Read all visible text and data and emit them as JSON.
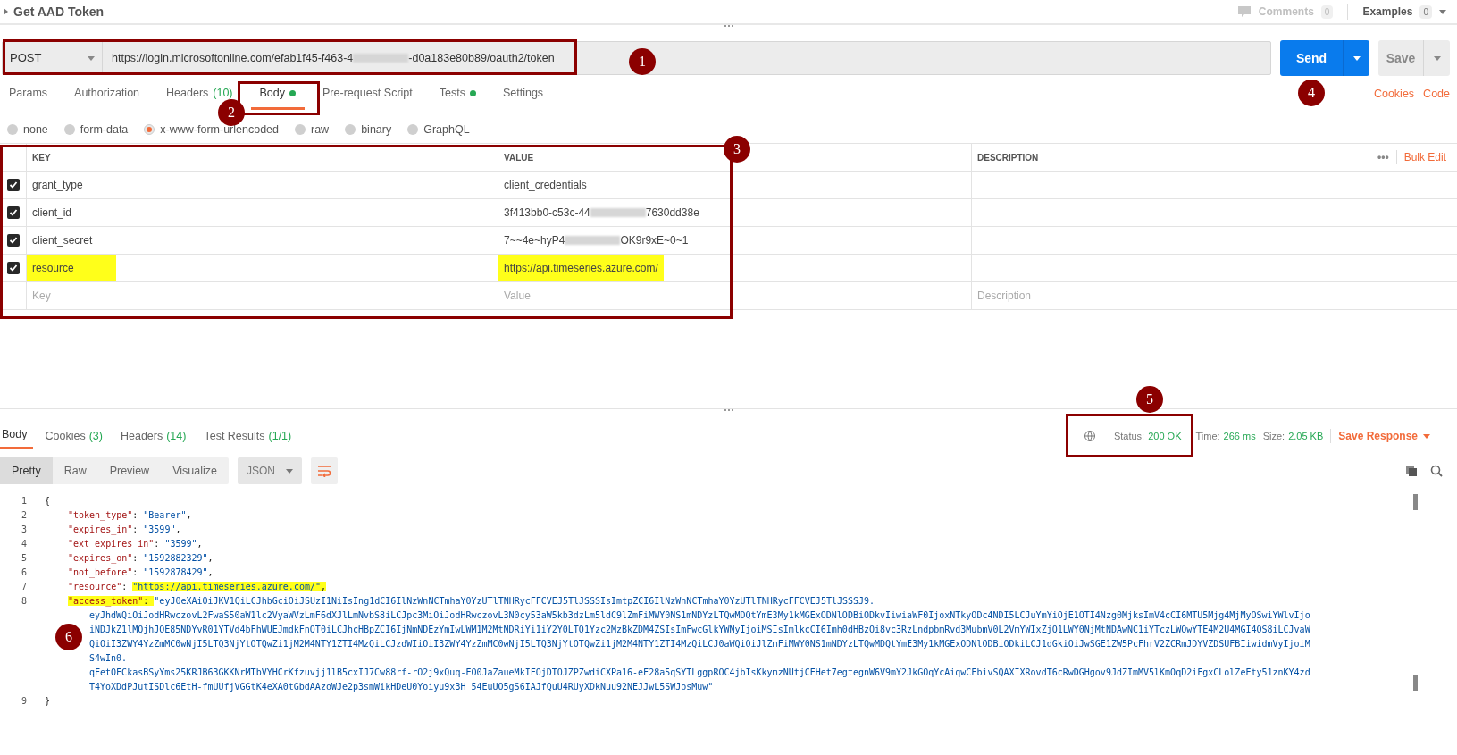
{
  "request": {
    "title": "Get AAD Token",
    "comments": {
      "label": "Comments",
      "count": "0",
      "disabled": true
    },
    "examples": {
      "label": "Examples",
      "count": "0"
    }
  },
  "url_bar": {
    "method": "POST",
    "url_parts": [
      {
        "kind": "text",
        "text": "https://login.microsoftonline.com/efab1f45-f463-4"
      },
      {
        "kind": "redacted"
      },
      {
        "kind": "text",
        "text": "-d0a183e80b89/oauth2/token"
      }
    ],
    "send": "Send",
    "save": "Save"
  },
  "request_tabs": [
    {
      "label": "Params",
      "selected": false
    },
    {
      "label": "Authorization",
      "selected": false
    },
    {
      "label": "Headers",
      "count": "(10)",
      "selected": false
    },
    {
      "label": "Body",
      "dot": true,
      "selected": true
    },
    {
      "label": "Pre-request Script",
      "selected": false
    },
    {
      "label": "Tests",
      "dot": true,
      "selected": false
    },
    {
      "label": "Settings",
      "selected": false
    }
  ],
  "request_links": [
    "Cookies",
    "Code"
  ],
  "body_types": [
    {
      "label": "none",
      "selected": false
    },
    {
      "label": "form-data",
      "selected": false
    },
    {
      "label": "x-www-form-urlencoded",
      "selected": true
    },
    {
      "label": "raw",
      "selected": false
    },
    {
      "label": "binary",
      "selected": false
    },
    {
      "label": "GraphQL",
      "selected": false
    }
  ],
  "params_table": {
    "columns": [
      "KEY",
      "VALUE",
      "DESCRIPTION"
    ],
    "more": "•••",
    "bulk_edit": "Bulk Edit",
    "rows": [
      {
        "checked": true,
        "highlighted": false,
        "key": "grant_type",
        "value": [
          {
            "kind": "text",
            "text": "client_credentials"
          }
        ]
      },
      {
        "checked": true,
        "highlighted": false,
        "key": "client_id",
        "value": [
          {
            "kind": "text",
            "text": "3f413bb0-c53c-44"
          },
          {
            "kind": "redacted"
          },
          {
            "kind": "text",
            "text": "7630dd38e"
          }
        ]
      },
      {
        "checked": true,
        "highlighted": false,
        "key": "client_secret",
        "value": [
          {
            "kind": "text",
            "text": "7~~4e~hyP4"
          },
          {
            "kind": "redacted"
          },
          {
            "kind": "text",
            "text": "OK9r9xE~0~1"
          }
        ]
      },
      {
        "checked": true,
        "highlighted": true,
        "key": "resource",
        "value": [
          {
            "kind": "text",
            "text": "https://api.timeseries.azure.com/"
          }
        ]
      }
    ],
    "placeholders": [
      "Key",
      "Value",
      "Description"
    ]
  },
  "response_tabs": [
    {
      "label": "Body",
      "selected": true
    },
    {
      "label": "Cookies",
      "count": "(3)",
      "selected": false
    },
    {
      "label": "Headers",
      "count": "(14)",
      "selected": false
    },
    {
      "label": "Test Results",
      "count": "(1/1)",
      "selected": false
    }
  ],
  "response_meta": {
    "status_label": "Status:",
    "status": "200 OK",
    "time_label": "Time:",
    "time": "266 ms",
    "size_label": "Size:",
    "size": "2.05 KB",
    "save_response": "Save Response"
  },
  "view_modes": [
    {
      "label": "Pretty",
      "selected": true
    },
    {
      "label": "Raw",
      "selected": false
    },
    {
      "label": "Preview",
      "selected": false
    },
    {
      "label": "Visualize",
      "selected": false
    }
  ],
  "format": "JSON",
  "code_lines": [
    {
      "number": "1",
      "tokens": [
        {
          "kind": "punct",
          "text": "{",
          "highlighted": false
        }
      ]
    },
    {
      "number": "2",
      "tokens": [
        {
          "kind": "key",
          "text": "\"token_type\"",
          "highlighted": false
        },
        {
          "kind": "punct",
          "text": ": ",
          "highlighted": false
        },
        {
          "kind": "string",
          "text": "\"Bearer\"",
          "highlighted": false
        },
        {
          "kind": "punct",
          "text": ",",
          "highlighted": false
        }
      ]
    },
    {
      "number": "3",
      "tokens": [
        {
          "kind": "key",
          "text": "\"expires_in\"",
          "highlighted": false
        },
        {
          "kind": "punct",
          "text": ": ",
          "highlighted": false
        },
        {
          "kind": "string",
          "text": "\"3599\"",
          "highlighted": false
        },
        {
          "kind": "punct",
          "text": ",",
          "highlighted": false
        }
      ]
    },
    {
      "number": "4",
      "tokens": [
        {
          "kind": "key",
          "text": "\"ext_expires_in\"",
          "highlighted": false
        },
        {
          "kind": "punct",
          "text": ": ",
          "highlighted": false
        },
        {
          "kind": "string",
          "text": "\"3599\"",
          "highlighted": false
        },
        {
          "kind": "punct",
          "text": ",",
          "highlighted": false
        }
      ]
    },
    {
      "number": "5",
      "tokens": [
        {
          "kind": "key",
          "text": "\"expires_on\"",
          "highlighted": false
        },
        {
          "kind": "punct",
          "text": ": ",
          "highlighted": false
        },
        {
          "kind": "string",
          "text": "\"1592882329\"",
          "highlighted": false
        },
        {
          "kind": "punct",
          "text": ",",
          "highlighted": false
        }
      ]
    },
    {
      "number": "6",
      "tokens": [
        {
          "kind": "key",
          "text": "\"not_before\"",
          "highlighted": false
        },
        {
          "kind": "punct",
          "text": ": ",
          "highlighted": false
        },
        {
          "kind": "string",
          "text": "\"1592878429\"",
          "highlighted": false
        },
        {
          "kind": "punct",
          "text": ",",
          "highlighted": false
        }
      ]
    },
    {
      "number": "7",
      "tokens": [
        {
          "kind": "key",
          "text": "\"resource\"",
          "highlighted": false
        },
        {
          "kind": "punct",
          "text": ": ",
          "highlighted": false
        },
        {
          "kind": "string",
          "text": "\"https://api.timeseries.azure.com/\"",
          "highlighted": true
        },
        {
          "kind": "punct",
          "text": ",",
          "highlighted": true
        }
      ]
    },
    {
      "number": "8",
      "tokens": [
        {
          "kind": "key",
          "text": "\"access_token\"",
          "highlighted": true
        },
        {
          "kind": "punct",
          "text": ": ",
          "highlighted": true
        },
        {
          "kind": "string",
          "text": "\"eyJ0eXAiOiJKV1QiLCJhbGciOiJSUzI1NiIsIng1dCI6IlNzWnNCTmhaY0YzUTlTNHRycFFCVEJ5TlJSSSIsImtpZCI6IlNzWnNCTmhaY0YzUTlTNHRycFFCVEJ5TlJSSSJ9.",
          "highlighted": false
        }
      ],
      "continuation": [
        "eyJhdWQiOiJodHRwczovL2FwaS50aW1lc2VyaWVzLmF6dXJlLmNvbS8iLCJpc3MiOiJodHRwczovL3N0cy53aW5kb3dzLm5ldC9lZmFiMWY0NS1mNDYzLTQwMDQtYmE3My1kMGExODNlODBiODkvIiwiaWF0IjoxNTkyODc4NDI5LCJuYmYiOjE1OTI4Nzg0MjksImV4cCI6MTU5Mjg4MjMyOSwiYWlvIjo",
        "iNDJkZ1lMQjhJOE85NDYvR01YTVd4bFhWUEJmdkFnQT0iLCJhcHBpZCI6IjNmNDEzYmIwLWM1M2MtNDRiYi1iY2Y0LTQ1Yzc2MzBkZDM4ZSIsImFwcGlkYWNyIjoiMSIsImlkcCI6Imh0dHBzOi8vc3RzLndpbmRvd3MubmV0L2VmYWIxZjQ1LWY0NjMtNDAwNC1iYTczLWQwYTE4M2U4MGI4OS8iLCJvaW",
        "QiOiI3ZWY4YzZmMC0wNjI5LTQ3NjYtOTQwZi1jM2M4NTY1ZTI4MzQiLCJzdWIiOiI3ZWY4YzZmMC0wNjI5LTQ3NjYtOTQwZi1jM2M4NTY1ZTI4MzQiLCJ0aWQiOiJlZmFiMWY0NS1mNDYzLTQwMDQtYmE3My1kMGExODNlODBiODkiLCJ1dGkiOiJwSGE1ZW5PcFhrV2ZCRmJDYVZDSUFBIiwidmVyIjoiM",
        "S4wIn0.",
        "qFetOFCkasBSyYms25KRJB63GKKNrMTbVYHCrKfzuvjj1lB5cxIJ7Cw88rf-rO2j9xQuq-EO0JaZaueMkIFOjDTOJZPZwdiCXPa16-eF28a5qSYTLggpROC4jbIsKkymzNUtjCEHet7egtegnW6V9mY2JkGOqYcAiqwCFbivSQAXIXRovdT6cRwDGHgov9JdZImMV5lKmOqD2iFgxCLolZeEty51znKY4zd",
        "T4YoXDdPJutISDlc6EtH-fmUUfjVGGtK4eXA0tGbdAAzoWJe2p3smWikHDeU0Yoiyu9x3H_54EuUO5gS6IAJfQuU4RUyXDkNuu92NEJJwL5SWJosMuw\""
      ]
    },
    {
      "number": "9",
      "tokens": [
        {
          "kind": "punct",
          "text": "}",
          "highlighted": false
        }
      ]
    }
  ],
  "annotations": [
    {
      "label": "1"
    },
    {
      "label": "2"
    },
    {
      "label": "3"
    },
    {
      "label": "4"
    },
    {
      "label": "5"
    },
    {
      "label": "6"
    }
  ]
}
